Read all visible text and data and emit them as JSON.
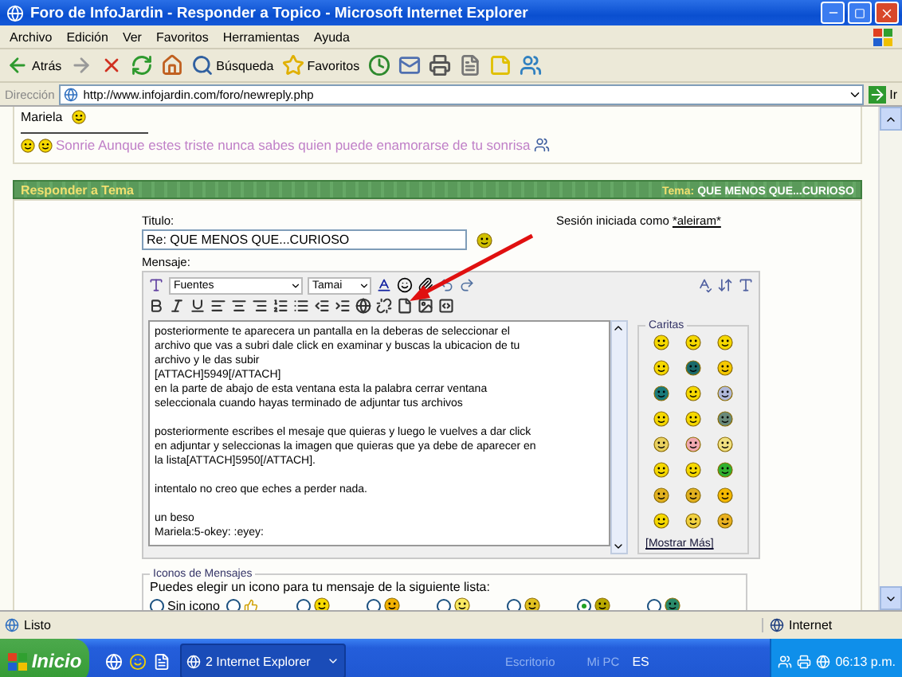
{
  "window": {
    "title": "Foro de InfoJardin - Responder a Topico - Microsoft Internet Explorer"
  },
  "menu": [
    "Archivo",
    "Edición",
    "Ver",
    "Favoritos",
    "Herramientas",
    "Ayuda"
  ],
  "toolbar": [
    {
      "kind": "back",
      "label": "Atrás"
    },
    {
      "kind": "forward"
    },
    {
      "kind": "stop"
    },
    {
      "kind": "refresh"
    },
    {
      "kind": "home"
    },
    {
      "kind": "search",
      "label": "Búsqueda"
    },
    {
      "kind": "favorites",
      "label": "Favoritos"
    },
    {
      "kind": "history"
    },
    {
      "kind": "mail"
    },
    {
      "kind": "print"
    },
    {
      "kind": "edit"
    },
    {
      "kind": "note"
    },
    {
      "kind": "messenger"
    }
  ],
  "address": {
    "label": "Dirección",
    "url": "http://www.infojardin.com/foro/newreply.php",
    "go": "Ir"
  },
  "post": {
    "author": "Mariela",
    "signature": "Sonrie Aunque estes triste nunca sabes quien puede enamorarse de tu sonrisa"
  },
  "reply_header": {
    "title": "Responder a Tema",
    "topic_label": "Tema:",
    "topic": "QUE MENOS QUE...CURIOSO"
  },
  "form": {
    "title_label": "Titulo:",
    "title_value": "Re: QUE MENOS QUE...CURIOSO",
    "session_text": "Sesión iniciada como",
    "session_user": "*aleiram*",
    "message_label": "Mensaje:"
  },
  "editor": {
    "font": "Fuentes",
    "size": "Tamai",
    "message": "posteriormente te aparecera un pantalla en la deberas de seleccionar el\narchivo que vas a subri dale click en examinar y buscas la ubicacion de tu\narchivo y le das subir\n[ATTACH]5949[/ATTACH]\nen la parte de abajo de esta ventana esta la palabra cerrar ventana\nseleccionala cuando hayas terminado de adjuntar tus archivos\n\nposteriormente escribes el mesaje que quieras y luego le vuelves a dar click\nen adjuntar y seleccionas la imagen que quieras que ya debe de aparecer en\nla lista[ATTACH]5950[/ATTACH].\n\nintentalo no creo que eches a perder nada.\n\nun beso\nMariela:5-okey: :eyey:"
  },
  "smilies": {
    "title": "Caritas",
    "more": "[Mostrar Más]"
  },
  "message_icons": {
    "legend": "Iconos de Mensajes",
    "prompt": "Puedes elegir un icono para tu mensaje de la siguiente lista:",
    "options": [
      {
        "kind": "none",
        "label": "Sin icono",
        "selected": false
      },
      {
        "kind": "thumb",
        "selected": false
      },
      {
        "kind": "grin",
        "selected": false
      },
      {
        "kind": "laugh",
        "selected": false
      },
      {
        "kind": "smile",
        "selected": false
      },
      {
        "kind": "cool",
        "selected": false
      },
      {
        "kind": "alien",
        "selected": true
      },
      {
        "kind": "green",
        "selected": false
      }
    ]
  },
  "status_bar": {
    "text": "Listo",
    "zone": "Internet"
  },
  "taskbar": {
    "start": "Inicio",
    "task": "2 Internet Explorer",
    "toolbars": [
      "Escritorio",
      "Mi PC"
    ],
    "language": "ES",
    "clock": "06:13 p.m."
  }
}
